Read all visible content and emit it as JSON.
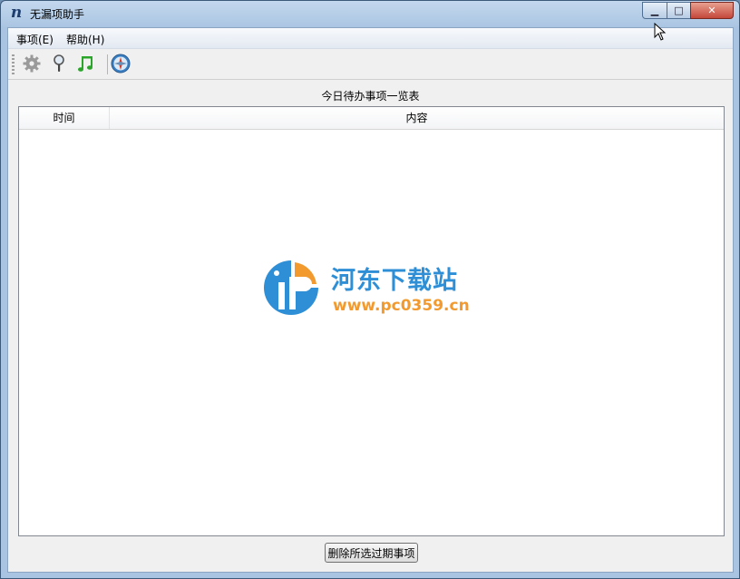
{
  "window": {
    "title": "无漏项助手",
    "app_icon_glyph": "n",
    "controls": {
      "minimize": "▁",
      "maximize": "□",
      "close": "✕"
    }
  },
  "menu": {
    "items": [
      {
        "label": "事项(E)"
      },
      {
        "label": "帮助(H)"
      }
    ]
  },
  "toolbar": {
    "icons": [
      "gear-icon",
      "magnifier-icon",
      "music-note-icon",
      "compass-icon"
    ]
  },
  "list": {
    "title": "今日待办事项一览表",
    "columns": [
      "时间",
      "内容"
    ],
    "rows": []
  },
  "watermark": {
    "name": "河东下载站",
    "url": "www.pc0359.cn"
  },
  "buttons": {
    "delete_expired": "删除所选过期事项"
  },
  "colors": {
    "titlebar": "#a9c4e2",
    "watermark_blue": "#2e8fd6",
    "watermark_orange": "#f29a2e"
  }
}
